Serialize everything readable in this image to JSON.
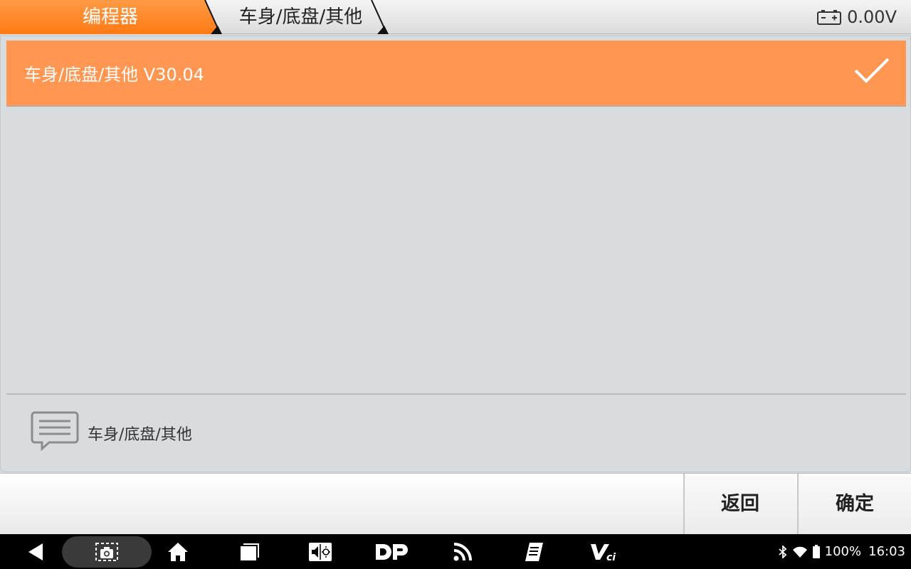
{
  "header": {
    "breadcrumbs": [
      "编程器",
      "车身/底盘/其他"
    ],
    "voltage": "0.00V"
  },
  "list": {
    "selected_item": "车身/底盘/其他  V30.04"
  },
  "description": {
    "text": "车身/底盘/其他"
  },
  "buttons": {
    "back": "返回",
    "confirm": "确定"
  },
  "status_bar": {
    "battery": "100%",
    "time": "16:03"
  },
  "colors": {
    "accent": "#ff9752",
    "active_tab": "#ff8a2b"
  }
}
